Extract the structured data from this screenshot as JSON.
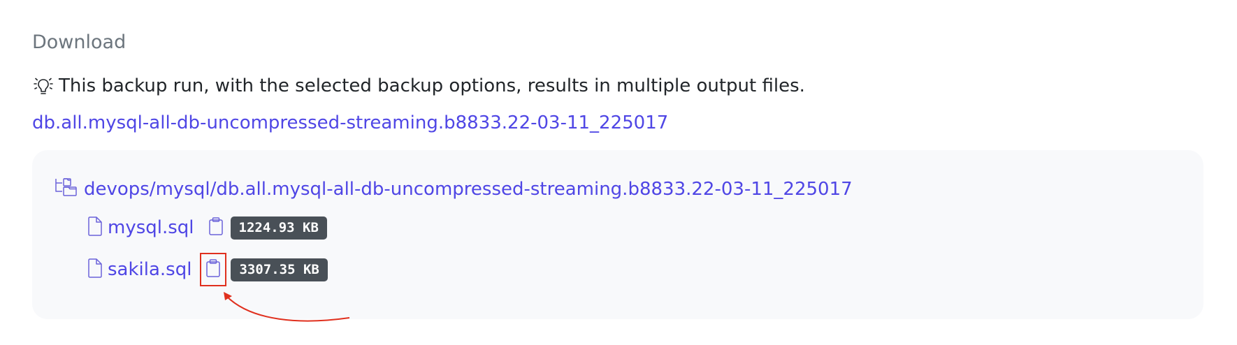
{
  "section": {
    "title": "Download"
  },
  "hint": {
    "icon": "lightbulb-idea-icon",
    "text": "This backup run, with the selected backup options, results in multiple output files."
  },
  "run_link": {
    "text": "db.all.mysql-all-db-uncompressed-streaming.b8833.22-03-11_225017"
  },
  "tree": {
    "folder": {
      "icon": "folder-tree-icon",
      "label": "devops/mysql/db.all.mysql-all-db-uncompressed-streaming.b8833.22-03-11_225017"
    },
    "files": [
      {
        "icon": "file-icon",
        "name": "mysql.sql",
        "copy_icon": "clipboard-icon",
        "size": "1224.93 KB"
      },
      {
        "icon": "file-icon",
        "name": "sakila.sql",
        "copy_icon": "clipboard-icon",
        "size": "3307.35 KB"
      }
    ]
  },
  "annotation": {
    "highlight_color": "#e0301e"
  },
  "colors": {
    "link": "#4f46e5",
    "muted": "#6c757d",
    "badge_bg": "#495057",
    "panel_bg": "#f8f9fb"
  }
}
